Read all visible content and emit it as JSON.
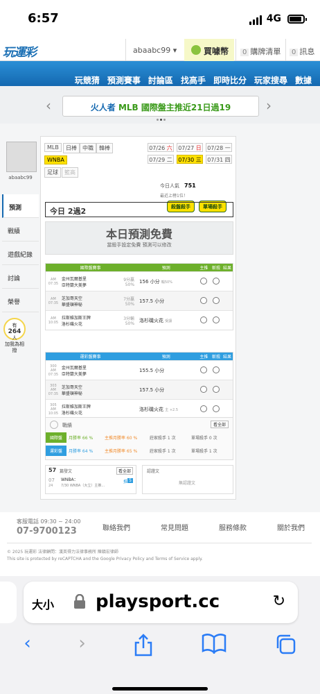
{
  "status": {
    "time": "6:57",
    "network": "4G"
  },
  "header": {
    "logo": "玩運彩",
    "username": "abaabc99",
    "coin_label": "買噱幣",
    "cart_count": "0",
    "cart_label": "購牌清單",
    "msg_count": "0",
    "msg_label": "訊息"
  },
  "nav": {
    "items": [
      "玩競猜",
      "預測賽事",
      "討論區",
      "找高手",
      "即時比分",
      "玩家搜尋",
      "數據"
    ]
  },
  "banner": {
    "text_team": "火人者",
    "text_main": "MLB 國際盤主推近21日過19"
  },
  "sidebar": {
    "username": "abaabc99",
    "items": [
      "預測",
      "戰績",
      "遊戲紀錄",
      "討論",
      "榮譽"
    ],
    "helper_count": "264",
    "helper_prefix": "有",
    "helper_unit": "人",
    "helper_label": "加我為相撥"
  },
  "leagues": {
    "row1": [
      "MLB",
      "日棒",
      "中職",
      "韓棒"
    ],
    "row2": [
      "WNBA"
    ],
    "row3": [
      "足球",
      "籃高"
    ]
  },
  "dates": [
    {
      "d": "07/26",
      "w": "六"
    },
    {
      "d": "07/27",
      "w": "日"
    },
    {
      "d": "07/28",
      "w": "一"
    },
    {
      "d": "07/29",
      "w": "二"
    },
    {
      "d": "07/30",
      "w": "三"
    },
    {
      "d": "07/31",
      "w": "四"
    }
  ],
  "stats": {
    "today_label": "今日人氣",
    "today_value": "751",
    "last_label": "最近上榜1位！",
    "badge1": "殺盤殺手",
    "badge2": "單場殺手"
  },
  "today": {
    "title": "今日 2過2"
  },
  "free": {
    "title": "本日預測免費",
    "subtitle": "當殺手設定免費 預測可以修改"
  },
  "intl": {
    "header": {
      "game": "國際盤賽事",
      "pick": "預測",
      "home": "主推",
      "kill": "斬殺",
      "result": "結果"
    },
    "rows": [
      {
        "time": "AM 07:35",
        "no": "",
        "team1": "金州瓦爾基里",
        "team2": "亞特蘭大美夢",
        "odds": "9分贏",
        "pct": "50%",
        "pick": "156 小分",
        "extra": "輸50%"
      },
      {
        "time": "AM 07:35",
        "no": "",
        "team1": "芝加哥天空",
        "team2": "華盛頓神秘",
        "odds": "7分贏",
        "pct": "50%",
        "pick": "157.5 小分",
        "extra": ""
      },
      {
        "time": "AM 10:05",
        "no": "",
        "team1": "拉斯維加斯王牌",
        "team2": "洛杉磯火花",
        "odds": "3分輸",
        "pct": "50%",
        "pick": "洛杉磯火花",
        "extra": "受讓"
      }
    ]
  },
  "local": {
    "header": {
      "game": "運彩盤賽事",
      "pick": "預測",
      "home": "主推",
      "kill": "斬殺",
      "result": "結果"
    },
    "rows": [
      {
        "time": "AM 07:35",
        "no": "300",
        "team1": "金州瓦爾基里",
        "team2": "亞特蘭大美夢",
        "odds": "",
        "pct": "",
        "pick": "155.5 小分",
        "extra": ""
      },
      {
        "time": "AM 07:35",
        "no": "303",
        "team1": "芝加哥天空",
        "team2": "華盛頓神秘",
        "odds": "",
        "pct": "",
        "pick": "157.5 小分",
        "extra": ""
      },
      {
        "time": "AM 10:05",
        "no": "305",
        "team1": "拉斯維加斯王牌",
        "team2": "洛杉磯火花",
        "odds": "",
        "pct": "",
        "pick": "洛杉磯火花",
        "extra": "主 +2.5"
      }
    ]
  },
  "summary": {
    "label": "戰績",
    "more": "看全部",
    "intl": {
      "tag": "國際盤",
      "win": "月勝率 66 %",
      "home": "主推月勝率 60 %",
      "kill": "莊家殺手 1 次",
      "single": "單場殺手 0 次"
    },
    "local": {
      "tag": "運彩盤",
      "win": "月勝率 64 %",
      "home": "主推月勝率 65 %",
      "kill": "莊家殺手 1 次",
      "single": "單場殺手 1 次"
    }
  },
  "posts": {
    "count": "57",
    "label": "篇發文",
    "more": "看全部",
    "date": "07",
    "date2": "24",
    "item_title": "WNBA：",
    "item_sub": "7/30 WNBA（大立）主推...",
    "reply_label": "推",
    "reply_count": "5",
    "empty_title": "認證文",
    "empty_text": "無認證文"
  },
  "footer": {
    "phone_label": "客服電話 09:30 ~ 24:00",
    "phone": "07-9700123",
    "links": [
      "聯絡我們",
      "常見問題",
      "服務條款",
      "關於我們"
    ],
    "copy": "© 2025 玩運彩 法律顧問：漢英得力法律事務所 陳鎮宏律師",
    "recaptcha": "This site is protected by reCAPTCHA and the Google Privacy Policy and Terms of Service apply."
  },
  "browser": {
    "size_label": "大小",
    "url": "playsport.cc"
  },
  "colors": {
    "nav": "#1468b0",
    "intl_green": "#6db02b",
    "local_blue": "#2f9ee0",
    "highlight": "#ffe100"
  }
}
